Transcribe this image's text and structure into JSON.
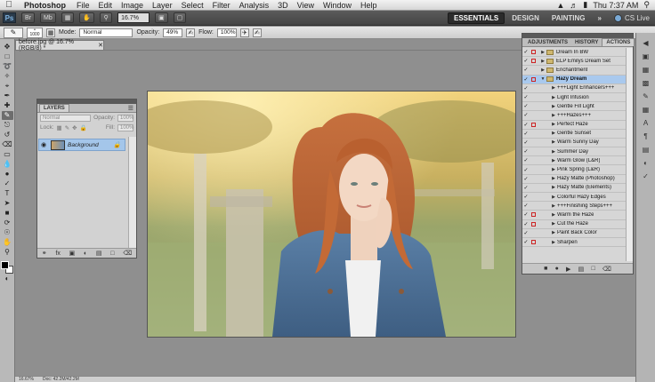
{
  "menubar": {
    "apple_icon": "apple-icon",
    "app_name": "Photoshop",
    "items": [
      "File",
      "Edit",
      "Image",
      "Layer",
      "Select",
      "Filter",
      "Analysis",
      "3D",
      "View",
      "Window",
      "Help"
    ],
    "clock": "Thu 7:37 AM"
  },
  "appbar": {
    "logo": "Ps",
    "zoom": "16.7%",
    "workspaces": [
      "ESSENTIALS",
      "DESIGN",
      "PAINTING"
    ],
    "more": "»",
    "cs_live": "CS Live"
  },
  "options": {
    "brush_size": "1000",
    "mode_label": "Mode:",
    "mode_value": "Normal",
    "opacity_label": "Opacity:",
    "opacity_value": "49%",
    "flow_label": "Flow:",
    "flow_value": "100%"
  },
  "document": {
    "tab_title": "before.jpg @ 16.7% (RGB/8) *"
  },
  "layers_panel": {
    "tab": "LAYERS",
    "blend_mode": "Normal",
    "opacity_label": "Opacity:",
    "opacity_value": "100%",
    "lock_label": "Lock:",
    "fill_label": "Fill:",
    "fill_value": "100%",
    "layer_name": "Background"
  },
  "actions_panel": {
    "tabs": [
      "ADJUSTMENTS",
      "HISTORY",
      "ACTIONS"
    ],
    "rows": [
      {
        "label": "Dream In BW",
        "kind": "set",
        "dlg": true
      },
      {
        "label": "ELP Emilys Dream Set",
        "kind": "set",
        "dlg": true
      },
      {
        "label": "Enchantment",
        "kind": "set",
        "dlg": false
      },
      {
        "label": "Hazy Dream",
        "kind": "set-open",
        "dlg": true,
        "selected": true
      },
      {
        "label": "+++Light Enhancers+++",
        "kind": "action",
        "dlg": false
      },
      {
        "label": "Light Infusion",
        "kind": "action",
        "dlg": false
      },
      {
        "label": "Gentle Fill Light",
        "kind": "action",
        "dlg": false
      },
      {
        "label": "+++Hazes+++",
        "kind": "action",
        "dlg": false
      },
      {
        "label": "Perfect Haze",
        "kind": "action",
        "dlg": true
      },
      {
        "label": "Gentle Sunset",
        "kind": "action",
        "dlg": false
      },
      {
        "label": "Warm Sunny Day",
        "kind": "action",
        "dlg": false
      },
      {
        "label": "Summer Day",
        "kind": "action",
        "dlg": false
      },
      {
        "label": "Warm Glow (L&R)",
        "kind": "action",
        "dlg": false
      },
      {
        "label": "Pink Spring (L&R)",
        "kind": "action",
        "dlg": false
      },
      {
        "label": "Hazy Matte (Photoshop)",
        "kind": "action",
        "dlg": false
      },
      {
        "label": "Hazy Matte (Elements)",
        "kind": "action",
        "dlg": false
      },
      {
        "label": "Colorful Hazy Edges",
        "kind": "action",
        "dlg": false
      },
      {
        "label": "+++Finishing Steps+++",
        "kind": "action",
        "dlg": false
      },
      {
        "label": "Warm the Haze",
        "kind": "action",
        "dlg": true
      },
      {
        "label": "Cut the Haze",
        "kind": "action",
        "dlg": true
      },
      {
        "label": "Paint Back Color",
        "kind": "action",
        "dlg": false
      },
      {
        "label": "Sharpen",
        "kind": "action",
        "dlg": true
      }
    ]
  },
  "statusbar": {
    "zoom": "16.67%",
    "doc_info": "Doc: 42.2M/42.2M"
  },
  "colors": {
    "selection": "#a9c9ee",
    "dialog_toggle": "#cc2222"
  }
}
